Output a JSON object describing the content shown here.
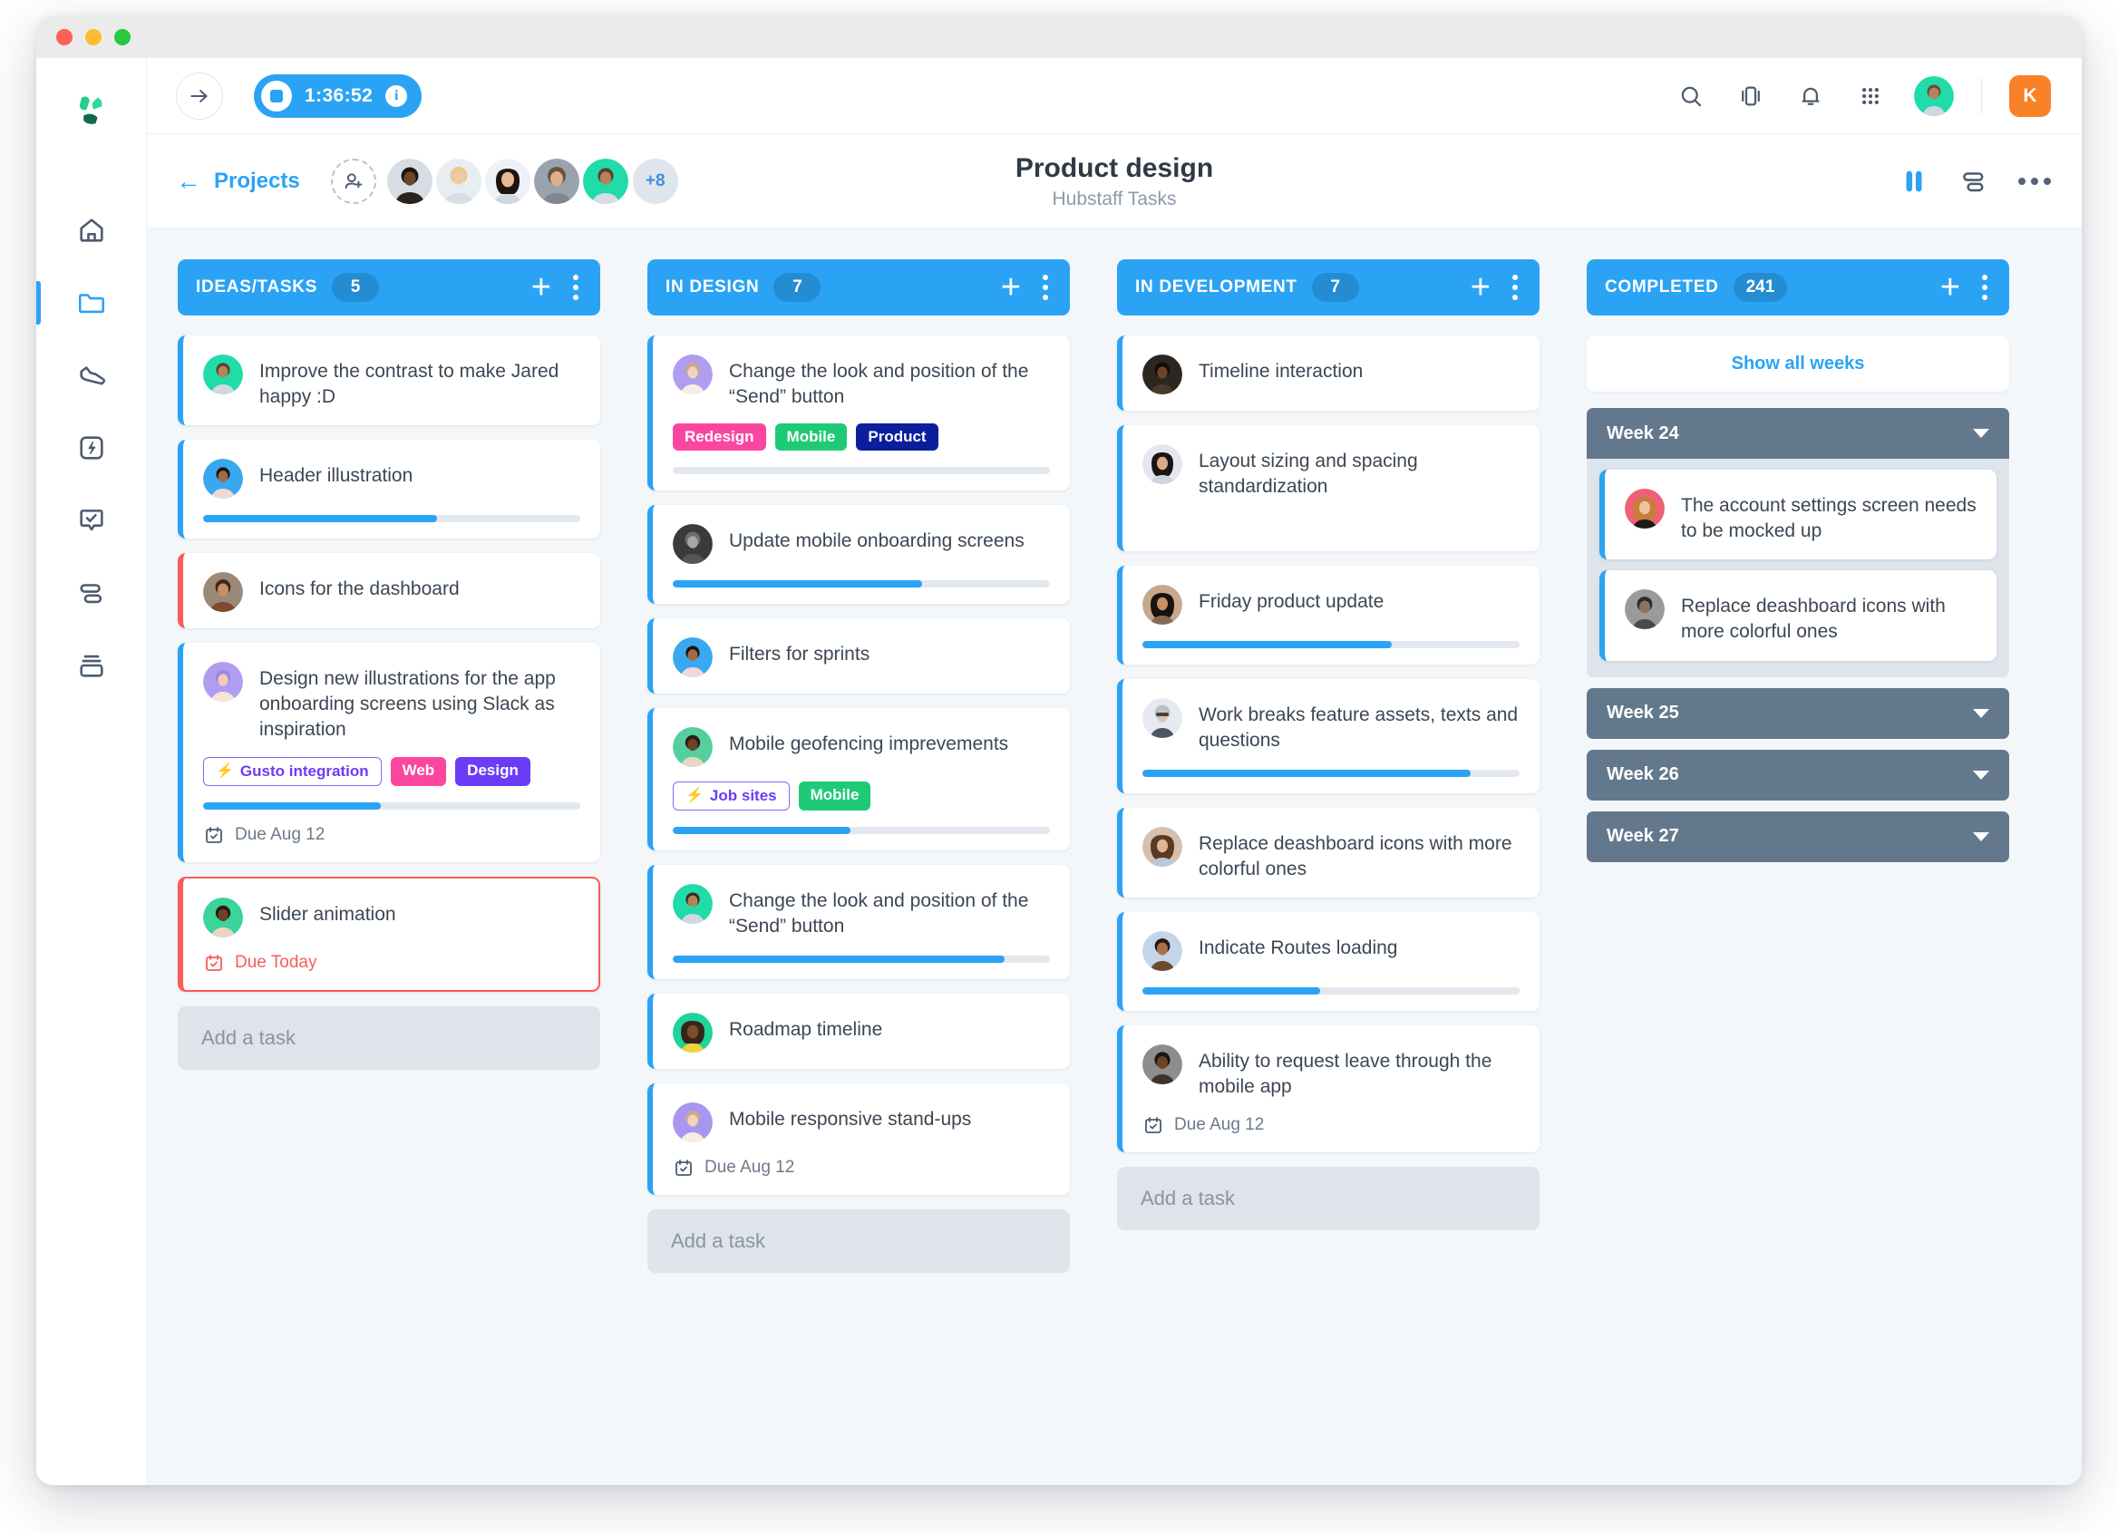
{
  "window": {
    "title_dots": [
      "close",
      "minimize",
      "maximize"
    ]
  },
  "topbar": {
    "timer": {
      "time": "1:36:52",
      "info_glyph": "i"
    },
    "icons": [
      "search-icon",
      "device-icon",
      "bell-icon",
      "apps-grid-icon"
    ],
    "user_badge": "K"
  },
  "projectbar": {
    "back_label": "Projects",
    "members_more": "+8",
    "title": "Product design",
    "subtitle": "Hubstaff Tasks"
  },
  "columns": [
    {
      "title": "IDEAS/TASKS",
      "count": "5",
      "add_task": "Add a task",
      "cards": [
        {
          "title": "Improve the contrast to make Jared happy :D",
          "accent": "blue",
          "avatar": "teal"
        },
        {
          "title": "Header illustration",
          "accent": "blue",
          "avatar": "blue",
          "progress": 62
        },
        {
          "title": "Icons for the dashboard",
          "accent": "red",
          "avatar": "brown"
        },
        {
          "title": "Design new illustrations for the app onboarding screens using Slack as inspiration",
          "accent": "blue",
          "avatar": "purple",
          "tags": [
            {
              "label": "Gusto integration",
              "style": "outline",
              "bolt": true
            },
            {
              "label": "Web",
              "style": "pink"
            },
            {
              "label": "Design",
              "style": "violet"
            }
          ],
          "progress": 47,
          "due": "Due Aug 12"
        },
        {
          "title": "Slider animation",
          "accent": "red",
          "outlined": true,
          "avatar": "green",
          "due": "Due Today",
          "due_red": true
        }
      ]
    },
    {
      "title": "IN DESIGN",
      "count": "7",
      "add_task": "Add a task",
      "cards": [
        {
          "title": "Change the look and position of the “Send” button",
          "accent": "blue",
          "avatar": "purple",
          "tags": [
            {
              "label": "Redesign",
              "style": "pink"
            },
            {
              "label": "Mobile",
              "style": "green"
            },
            {
              "label": "Product",
              "style": "navy"
            }
          ],
          "progress": 0
        },
        {
          "title": "Update mobile onboarding screens",
          "accent": "blue",
          "avatar": "gray",
          "progress": 66
        },
        {
          "title": "Filters for sprints",
          "accent": "blue",
          "avatar": "blue"
        },
        {
          "title": "Mobile geofencing imprevements",
          "accent": "blue",
          "avatar": "green",
          "tags": [
            {
              "label": "Job sites",
              "style": "outline",
              "bolt": true
            },
            {
              "label": "Mobile",
              "style": "green"
            }
          ],
          "progress": 47
        },
        {
          "title": "Change the look and position of the “Send” button",
          "accent": "blue",
          "avatar": "teal",
          "progress": 88
        },
        {
          "title": "Roadmap timeline",
          "accent": "blue",
          "avatar": "yellow"
        },
        {
          "title": "Mobile responsive stand-ups",
          "accent": "blue",
          "avatar": "purple",
          "due": "Due Aug 12"
        }
      ]
    },
    {
      "title": "IN DEVELOPMENT",
      "count": "7",
      "add_task": "Add a task",
      "cards": [
        {
          "title": "Timeline interaction",
          "accent": "blue",
          "avatar": "dark"
        },
        {
          "title": "Layout sizing and spacing standardization",
          "accent": "blue",
          "avatar": "lightgray",
          "tall": true
        },
        {
          "title": "Friday product update",
          "accent": "blue",
          "avatar": "tan",
          "progress": 66
        },
        {
          "title": "Work breaks feature assets, texts and questions",
          "accent": "blue",
          "avatar": "lightgray",
          "progress": 87
        },
        {
          "title": "Replace deashboard icons with more colorful ones",
          "accent": "blue",
          "avatar": "brown"
        },
        {
          "title": "Indicate Routes loading",
          "accent": "blue",
          "avatar": "blue",
          "progress": 47
        },
        {
          "title": "Ability to request leave through the mobile app",
          "accent": "blue",
          "avatar": "dark",
          "due": "Due Aug 12"
        }
      ]
    },
    {
      "title": "COMPLETED",
      "count": "241",
      "show_all_weeks": "Show all weeks",
      "weeks": [
        {
          "label": "Week 24",
          "open": true,
          "cards": [
            {
              "title": "The account settings screen needs to be mocked up",
              "accent": "blue",
              "avatar": "pink"
            },
            {
              "title": "Replace deashboard icons with more colorful ones",
              "accent": "blue",
              "avatar": "gray"
            }
          ]
        },
        {
          "label": "Week 25",
          "open": false,
          "cards": []
        },
        {
          "label": "Week 26",
          "open": false,
          "cards": []
        },
        {
          "label": "Week 27",
          "open": false,
          "cards": []
        }
      ]
    }
  ],
  "sidebar": {
    "items": [
      {
        "icon": "home-icon",
        "active": false
      },
      {
        "icon": "folder-icon",
        "active": true
      },
      {
        "icon": "shoe-icon",
        "active": false
      },
      {
        "icon": "bolt-square-icon",
        "active": false
      },
      {
        "icon": "check-bubble-icon",
        "active": false
      },
      {
        "icon": "list-icon",
        "active": false
      },
      {
        "icon": "archive-icon",
        "active": false
      }
    ]
  },
  "colors": {
    "accent_blue": "#2ba3f5",
    "red": "#fb5a5a",
    "pink": "#fb46a0",
    "green": "#1fca77",
    "navy": "#0b1f9c",
    "violet": "#6b3cf5",
    "orange": "#f98128",
    "week_header": "#64788d",
    "board_bg": "#f3f7fa"
  }
}
